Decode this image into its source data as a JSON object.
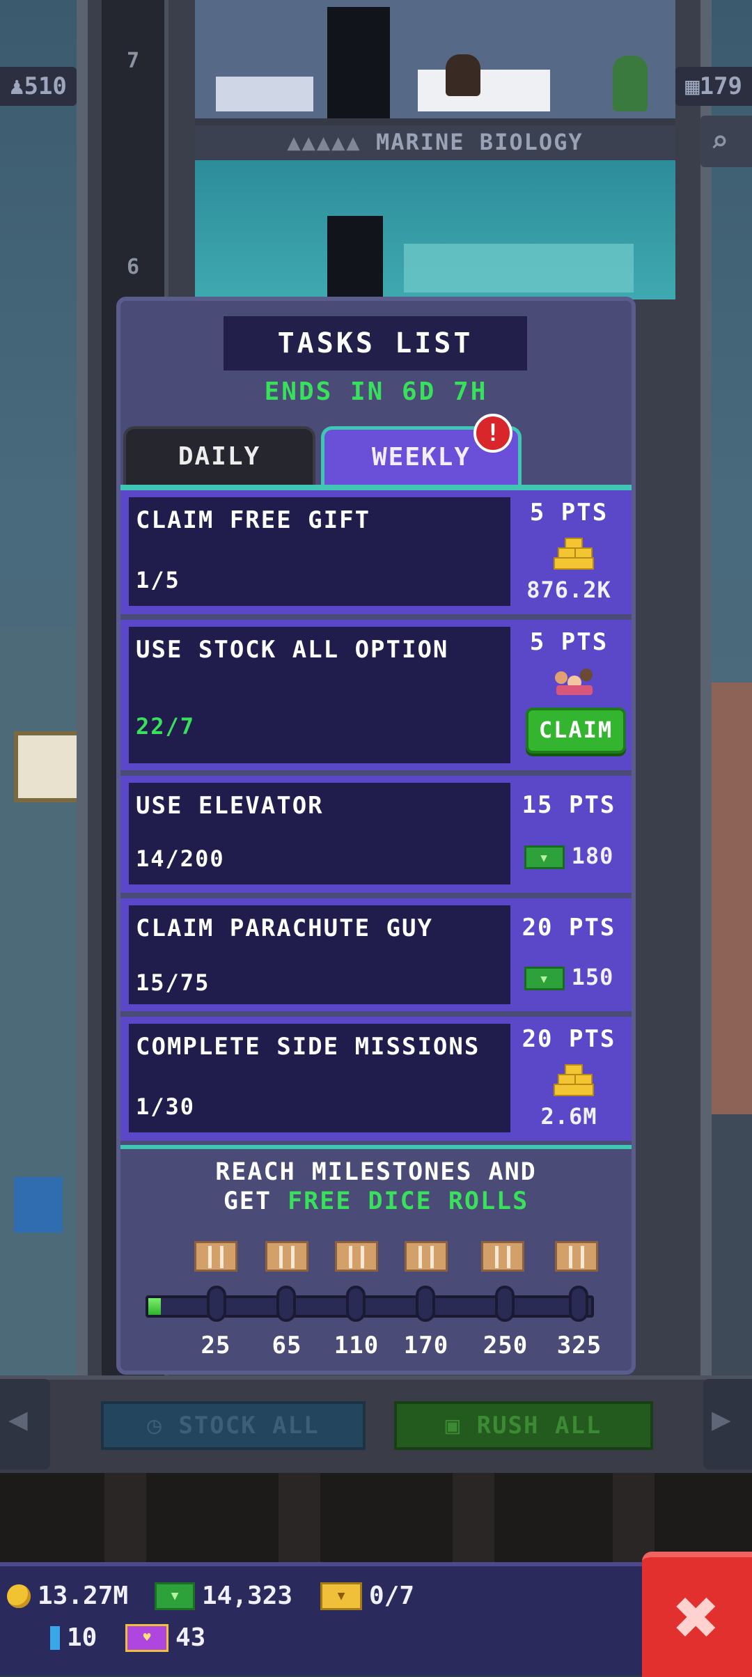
{
  "background": {
    "left_counter": "510",
    "right_counter": "179",
    "floor_banner": "MARINE BIOLOGY",
    "floor_numbers": [
      "7",
      "6"
    ],
    "bottom_buttons": {
      "stock_all": "STOCK ALL",
      "rush_all": "RUSH ALL"
    }
  },
  "modal": {
    "title": "TASKS LIST",
    "ends_in": "ENDS IN 6D 7H",
    "tabs": [
      {
        "label": "DAILY",
        "active": false
      },
      {
        "label": "WEEKLY",
        "active": true,
        "alert": "!"
      }
    ],
    "tasks": [
      {
        "name": "CLAIM FREE GIFT",
        "progress": "1/5",
        "points": "5 PTS",
        "reward_icon": "gold-bars-icon",
        "reward": "876.2K",
        "completed": false
      },
      {
        "name": "USE STOCK ALL OPTION",
        "progress": "22/7",
        "points": "5 PTS",
        "reward_icon": "bitizens-icon",
        "reward": "",
        "claim_label": "CLAIM",
        "completed": true
      },
      {
        "name": "USE ELEVATOR",
        "progress": "14/200",
        "points": "15 PTS",
        "reward_icon": "bux-icon",
        "reward": "180",
        "completed": false
      },
      {
        "name": "CLAIM PARACHUTE GUY",
        "progress": "15/75",
        "points": "20 PTS",
        "reward_icon": "bux-icon",
        "reward": "150",
        "completed": false
      },
      {
        "name": "COMPLETE SIDE MISSIONS",
        "progress": "1/30",
        "points": "20 PTS",
        "reward_icon": "gold-bars-icon",
        "reward": "2.6M",
        "completed": false
      }
    ],
    "milestones": {
      "text_line1": "REACH MILESTONES AND",
      "text_line2_prefix": "GET ",
      "text_line2_highlight": "FREE DICE ROLLS",
      "values": [
        "25",
        "65",
        "110",
        "170",
        "250",
        "325"
      ],
      "current_points": 5,
      "max_points": 325
    }
  },
  "footer": {
    "coins": "13.27M",
    "bux": "14,323",
    "tickets": "0/7",
    "gems": "10",
    "vip": "43"
  },
  "colors": {
    "accent_green": "#39e05b",
    "modal_bg": "#4a4b76",
    "task_purple": "#5b48c8",
    "close_red": "#e2302e"
  }
}
